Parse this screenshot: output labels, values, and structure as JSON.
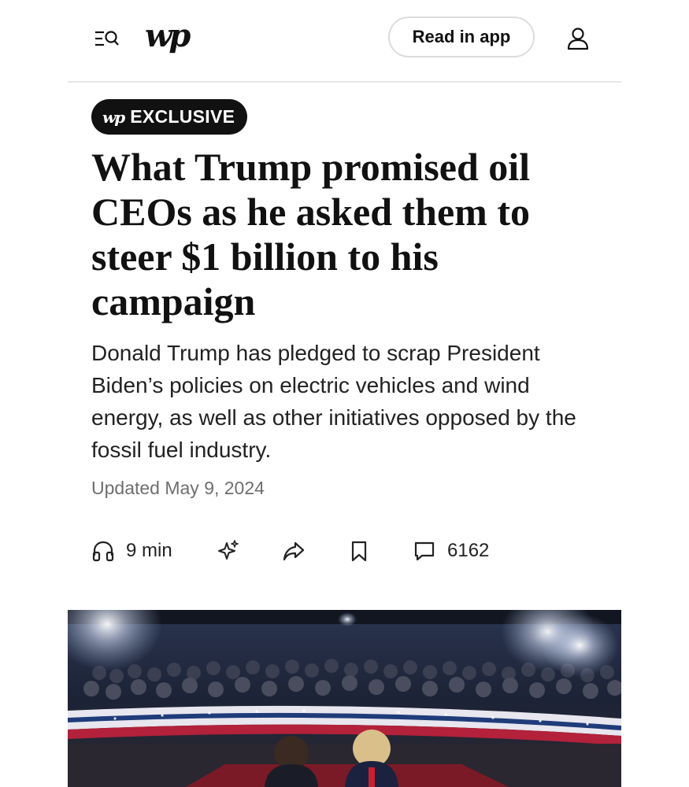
{
  "header": {
    "logo_text": "wp",
    "read_in_app_label": "Read in app",
    "icons": [
      "menu-search-icon",
      "user-icon"
    ]
  },
  "article": {
    "badge": {
      "logo_text": "wp",
      "label": "EXCLUSIVE"
    },
    "headline": "What Trump promised oil CEOs as he asked them to steer $1 billion to his campaign",
    "dek": "Donald Trump has pledged to scrap President Biden’s policies on electric vehicles and wind energy, as well as other initiatives opposed by the fossil fuel industry.",
    "timestamp": "Updated May 9, 2024"
  },
  "toolbar": {
    "listen_time": "9 min",
    "comment_count": "6162",
    "icons": [
      "headphones-icon",
      "sparkle-icon",
      "share-icon",
      "bookmark-icon",
      "comment-icon"
    ]
  },
  "colors": {
    "text": "#111111",
    "muted": "#6e6e6e",
    "badge_bg": "#111111",
    "divider": "#e6e6e6"
  }
}
